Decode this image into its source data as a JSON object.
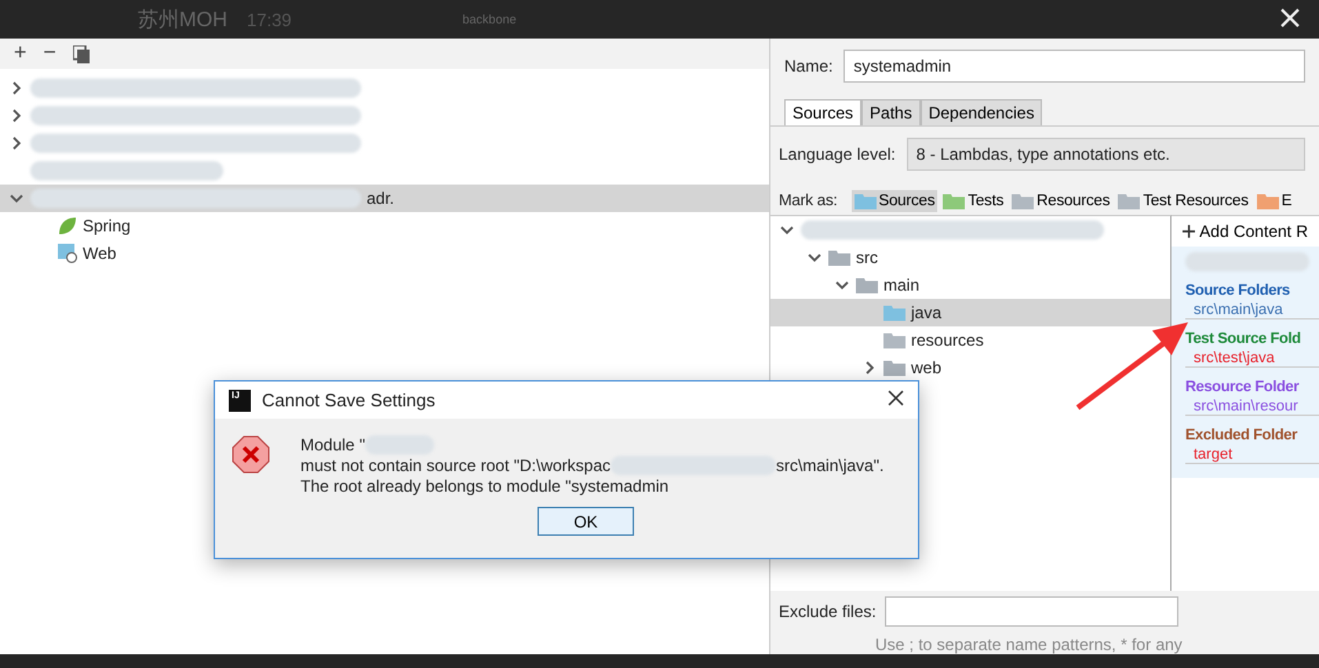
{
  "background_bar": {
    "chat_name": "苏州MOH",
    "time": "17:39",
    "file": "backbone"
  },
  "left_panel": {
    "toolbar": [
      "+",
      "−"
    ],
    "tree": [
      {
        "kind": "redacted",
        "expanded": false,
        "selected": false
      },
      {
        "kind": "redacted",
        "expanded": false,
        "selected": false
      },
      {
        "kind": "redacted",
        "expanded": false,
        "selected": false
      },
      {
        "kind": "redacted_leaf",
        "selected": false
      },
      {
        "kind": "redacted",
        "expanded": true,
        "selected": true,
        "label": "adr.",
        "children": [
          {
            "kind": "spring",
            "label": "Spring",
            "selected": false
          },
          {
            "kind": "web",
            "label": "Web",
            "selected": false
          }
        ]
      }
    ]
  },
  "right_panel": {
    "name_label": "Name:",
    "name_value": "systemadmin",
    "tabs": [
      {
        "label": "Sources",
        "selected": true
      },
      {
        "label": "Paths",
        "selected": false
      },
      {
        "label": "Dependencies",
        "selected": false
      }
    ],
    "language_label": "Language level:",
    "language_value": "8 - Lambdas, type annotations etc.",
    "mark_label": "Mark as:",
    "mark_buttons": [
      {
        "label": "Sources",
        "kind": "sources",
        "selected": true
      },
      {
        "label": "Tests",
        "kind": "tests",
        "selected": false
      },
      {
        "label": "Resources",
        "kind": "resources",
        "selected": false
      },
      {
        "label": "Test Resources",
        "kind": "test_resources",
        "selected": false
      },
      {
        "label": "E",
        "kind": "excluded",
        "selected": false
      }
    ],
    "tree": [
      {
        "kind": "redacted",
        "expanded": true,
        "selected": false,
        "children": [
          {
            "kind": "folder",
            "label": "src",
            "expanded": true,
            "selected": false,
            "children": [
              {
                "kind": "folder",
                "label": "main",
                "expanded": true,
                "selected": false,
                "children": [
                  {
                    "kind": "source",
                    "label": "java",
                    "selected": true
                  },
                  {
                    "kind": "resource",
                    "label": "resources",
                    "selected": false
                  },
                  {
                    "kind": "folder",
                    "label": "web",
                    "expanded": false,
                    "selected": false
                  }
                ]
              }
            ]
          }
        ]
      }
    ],
    "add_content_root": "Add Content R",
    "roots": [
      {
        "kind": "source",
        "title": "Source Folders",
        "color": "#1f5fb0",
        "path": "src\\main\\java"
      },
      {
        "kind": "test",
        "title": "Test Source Fold",
        "color": "#1e8a3a",
        "path": "src\\test\\java"
      },
      {
        "kind": "resource",
        "title": "Resource Folder",
        "color": "#8a4fe0",
        "path": "src\\main\\resour"
      },
      {
        "kind": "excluded",
        "title": "Excluded Folder",
        "color": "#a0522d",
        "path": "target"
      }
    ],
    "exclude_label": "Exclude files:",
    "exclude_hint": "Use ; to separate name patterns, * for any"
  },
  "dialog": {
    "title": "Cannot Save Settings",
    "app_icon": "IJ",
    "lines": [
      [
        {
          "text": "Module \""
        },
        {
          "kind": "redacted"
        }
      ],
      [
        {
          "text": "must not contain source root \"D:\\workspac"
        },
        {
          "kind": "redacted"
        },
        {
          "text": "src\\main\\java\"."
        }
      ],
      [
        {
          "text": "The root already belongs to module \"systemadmin"
        }
      ]
    ],
    "button": "OK"
  }
}
